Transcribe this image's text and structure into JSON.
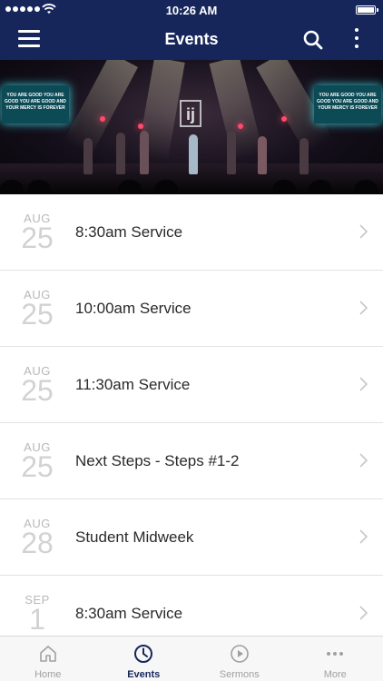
{
  "status_bar": {
    "time": "10:26 AM",
    "battery_level": 1.0
  },
  "nav": {
    "title": "Events",
    "icons": [
      "menu-icon",
      "search-icon",
      "more-vertical-icon"
    ]
  },
  "hero": {
    "screen_text_left": "YOU ARE GOOD YOU ARE GOOD YOU ARE GOOD AND YOUR MERCY IS FOREVER",
    "screen_text_right": "YOU ARE GOOD YOU ARE GOOD YOU ARE GOOD AND YOUR MERCY IS FOREVER",
    "logo": "ij"
  },
  "events": [
    {
      "month": "AUG",
      "day": "25",
      "title": "8:30am Service"
    },
    {
      "month": "AUG",
      "day": "25",
      "title": "10:00am Service"
    },
    {
      "month": "AUG",
      "day": "25",
      "title": "11:30am Service"
    },
    {
      "month": "AUG",
      "day": "25",
      "title": "Next Steps - Steps #1-2"
    },
    {
      "month": "AUG",
      "day": "28",
      "title": "Student Midweek"
    },
    {
      "month": "SEP",
      "day": "1",
      "title": "8:30am Service"
    }
  ],
  "tabs": [
    {
      "label": "Home",
      "icon": "home-icon",
      "active": false
    },
    {
      "label": "Events",
      "icon": "clock-icon",
      "active": true
    },
    {
      "label": "Sermons",
      "icon": "play-circle-icon",
      "active": false
    },
    {
      "label": "More",
      "icon": "more-horizontal-icon",
      "active": false
    }
  ],
  "colors": {
    "nav_background": "#16265a",
    "tab_active": "#16265a",
    "tab_inactive": "#a0a0a0",
    "date_gray": "#d2d2d2"
  }
}
